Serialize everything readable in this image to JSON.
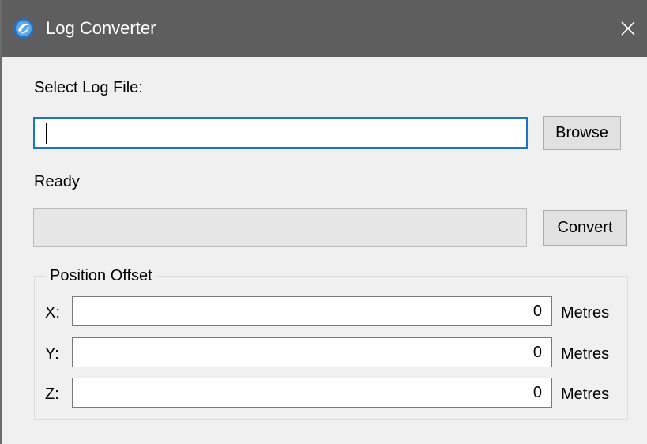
{
  "window": {
    "title": "Log Converter",
    "close_symbol": "✕",
    "app_icon": "app-logo-icon"
  },
  "file": {
    "label": "Select Log File:",
    "value": "",
    "browse_label": "Browse"
  },
  "status": {
    "text": "Ready",
    "progress_percent": 0,
    "convert_label": "Convert"
  },
  "offset": {
    "title": "Position Offset",
    "rows": [
      {
        "axis": "X:",
        "value": "0",
        "unit": "Metres"
      },
      {
        "axis": "Y:",
        "value": "0",
        "unit": "Metres"
      },
      {
        "axis": "Z:",
        "value": "0",
        "unit": "Metres"
      }
    ]
  },
  "colors": {
    "titlebar": "#5e5e5e",
    "focus_border": "#1b74c7",
    "progress_fill": "#06b025"
  }
}
